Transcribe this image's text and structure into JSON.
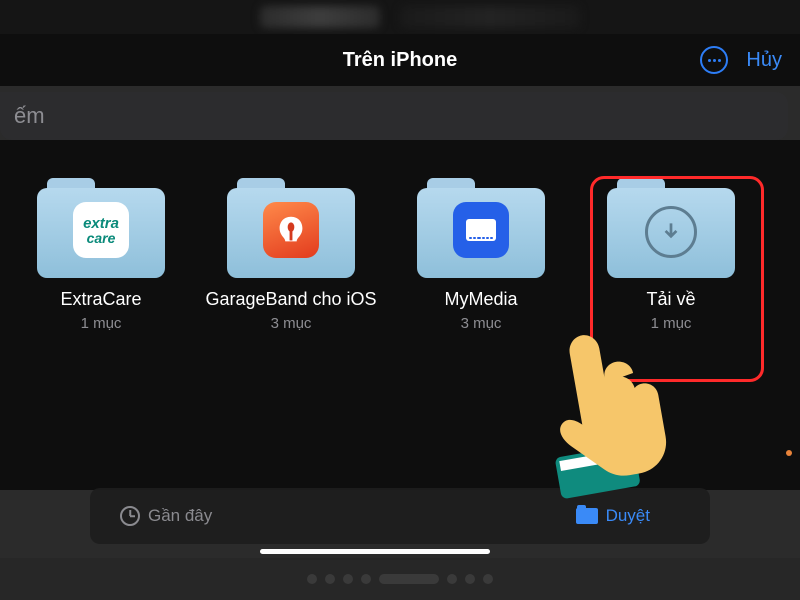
{
  "header": {
    "title": "Trên iPhone",
    "cancel_label": "Hủy"
  },
  "search": {
    "placeholder_fragment": "ếm"
  },
  "folders": [
    {
      "name": "ExtraCare",
      "sub": "1 mục",
      "badge": "extracare"
    },
    {
      "name": "GarageBand cho iOS",
      "sub": "3 mục",
      "badge": "garage"
    },
    {
      "name": "MyMedia",
      "sub": "3 mục",
      "badge": "mymedia"
    },
    {
      "name": "Tải về",
      "sub": "1 mục",
      "badge": "download"
    }
  ],
  "tabs": {
    "recent": "Gần đây",
    "browse": "Duyệt"
  }
}
